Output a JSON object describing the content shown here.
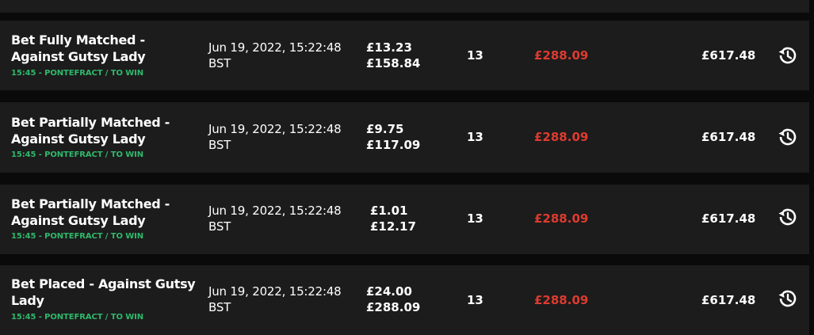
{
  "rows": [
    {
      "title": "Bet Fully Matched - Against Gutsy Lady",
      "subtitle": "15:45 - PONTEFRACT / TO WIN",
      "date_line1": "Jun 19, 2022, 15:22:48",
      "date_line2": "BST",
      "stake": "£13.23",
      "potential": "£158.84",
      "odds": "13",
      "liability": "£288.09",
      "balance": "£617.48",
      "icon": "history-icon"
    },
    {
      "title": "Bet Partially Matched - Against Gutsy Lady",
      "subtitle": "15:45 - PONTEFRACT / TO WIN",
      "date_line1": "Jun 19, 2022, 15:22:48",
      "date_line2": "BST",
      "stake": "£9.75",
      "potential": "£117.09",
      "odds": "13",
      "liability": "£288.09",
      "balance": "£617.48",
      "icon": "history-icon"
    },
    {
      "title": "Bet Partially Matched - Against Gutsy Lady",
      "subtitle": "15:45 - PONTEFRACT / TO WIN",
      "date_line1": "Jun 19, 2022, 15:22:48",
      "date_line2": "BST",
      "stake": "£1.01",
      "potential": "£12.17",
      "odds": "13",
      "liability": "£288.09",
      "balance": "£617.48",
      "icon": "history-icon"
    },
    {
      "title": "Bet Placed - Against Gutsy Lady",
      "subtitle": "15:45 - PONTEFRACT / TO WIN",
      "date_line1": "Jun 19, 2022, 15:22:48",
      "date_line2": "BST",
      "stake": "£24.00",
      "potential": "£288.09",
      "odds": "13",
      "liability": "£288.09",
      "balance": "£617.48",
      "icon": "history-icon"
    }
  ],
  "colors": {
    "row_bg": "#1c1c1c",
    "page_bg": "#0a0a0a",
    "subtitle_green": "#2fb86b",
    "liability_red": "#e03a2f",
    "text": "#ffffff"
  }
}
